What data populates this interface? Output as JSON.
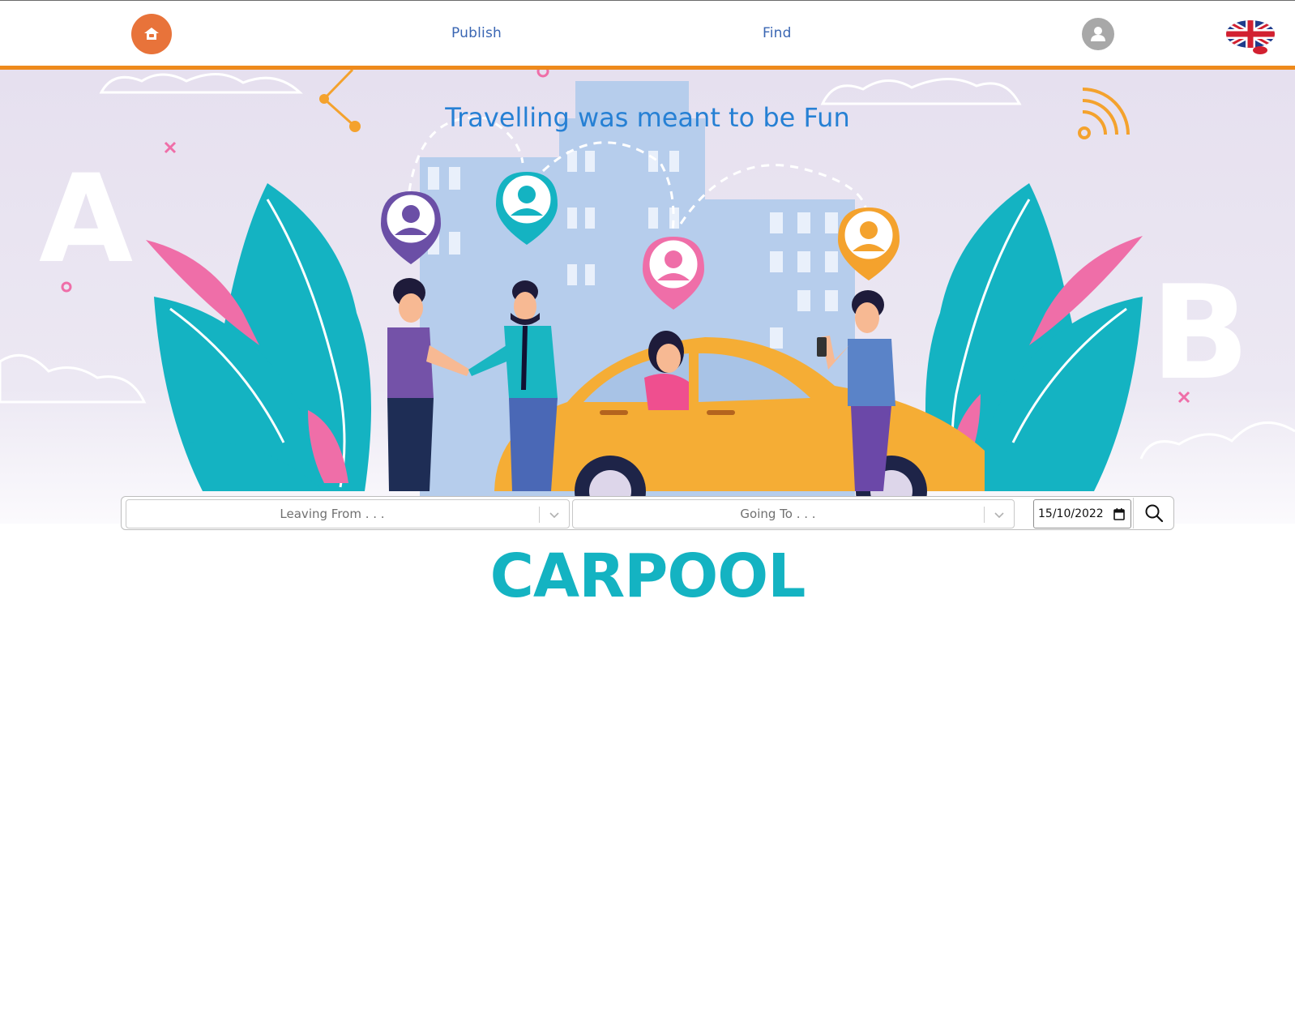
{
  "nav": {
    "publish_label": "Publish",
    "find_label": "Find",
    "logo_icon": "home-car-icon",
    "avatar_icon": "user-icon",
    "language_icon": "uk-flag-icon"
  },
  "hero": {
    "tagline": "Travelling was meant to be Fun",
    "letter_a": "A",
    "letter_b": "B"
  },
  "search": {
    "from_placeholder": "Leaving From . . .",
    "to_placeholder": "Going To . . .",
    "date_value": "15/10/2022",
    "search_icon": "search-icon"
  },
  "brand": {
    "title": "CARPOOL"
  },
  "colors": {
    "accent_orange": "#ee8a1c",
    "logo_orange": "#e8733a",
    "link_blue": "#3a66b3",
    "tagline_blue": "#2680d4",
    "brand_teal": "#14b3c2"
  }
}
